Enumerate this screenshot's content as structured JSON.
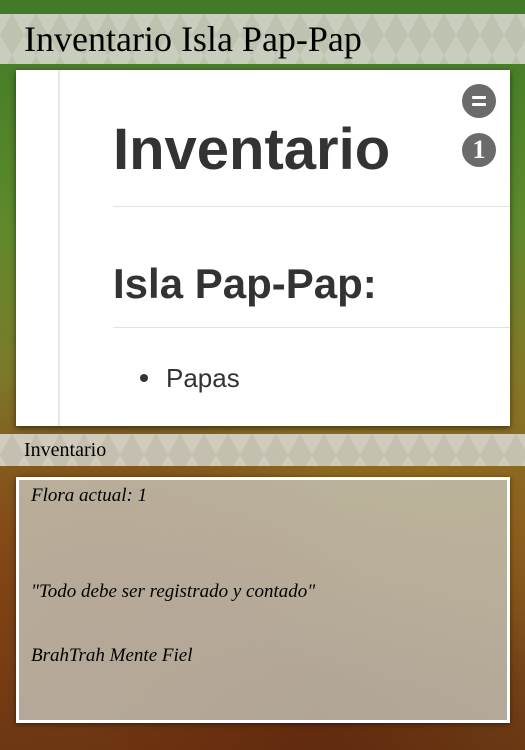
{
  "header": {
    "title": "Inventario Isla Pap-Pap"
  },
  "card_image": {
    "heading": "Inventario",
    "subheading": "Isla Pap-Pap:",
    "items": [
      "Papas"
    ]
  },
  "card_controls": {
    "menu_icon": "equals-icon",
    "count": "1"
  },
  "subheader": {
    "title": "Inventario"
  },
  "description": {
    "flora": "Flora actual: 1",
    "quote": "\"Todo debe ser registrado y contado\"",
    "author": "BrahTrah Mente Fiel"
  }
}
